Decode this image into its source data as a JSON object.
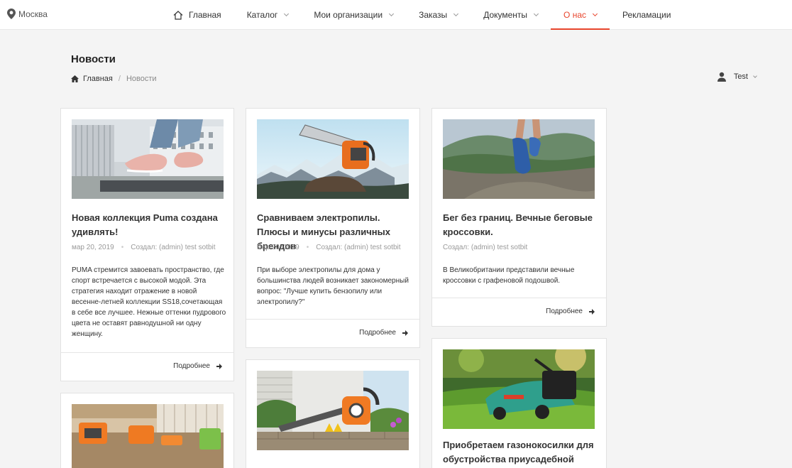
{
  "header": {
    "city": "Москва",
    "nav": [
      {
        "label": "Главная"
      },
      {
        "label": "Каталог"
      },
      {
        "label": "Мои организации"
      },
      {
        "label": "Заказы"
      },
      {
        "label": "Документы"
      },
      {
        "label": "О нас"
      },
      {
        "label": "Рекламации"
      }
    ]
  },
  "page": {
    "title": "Новости",
    "breadcrumb": {
      "home": "Главная",
      "separator": "/",
      "current": "Новости"
    },
    "user": "Test"
  },
  "colors": {
    "accent": "#e8452c"
  },
  "news": [
    {
      "image": "sneakers-photo",
      "title": "Новая коллекция Puma создана удивлять!",
      "date": "мар 20, 2019",
      "author": "Создал: (admin) test sotbit",
      "text": "PUMA стремится завоевать пространство, где спорт встречается с высокой модой. Эта стратегия находит отражение в новой весенне-летней коллекции SS18,сочетающая  в себе все лучшее. Нежные оттенки пудрового цвета не оставят равнодушной ни одну женщину.",
      "more": "Подробнее"
    },
    {
      "image": "chainsaw-photo",
      "title": "Сравниваем электропилы. Плюсы и минусы различных брендов",
      "date": "мар 20, 2019",
      "author": "Создал: (admin) test sotbit",
      "text": "При выборе электропилы для дома у большинства людей возникает закономерный вопрос: \"Лучше купить бензопилу или электропилу?\"",
      "more": "Подробнее"
    },
    {
      "image": "running-shoes-photo",
      "title": "Бег без границ. Вечные беговые кроссовки.",
      "author": "Создал: (admin) test sotbit",
      "text": "В Великобритании представили вечные кроссовки с графеновой подошвой.",
      "more": "Подробнее"
    },
    {
      "image": "garden-tools-photo"
    },
    {
      "image": "leaf-blower-photo"
    },
    {
      "image": "lawn-mower-photo",
      "title": "Приобретаем газонокосилки для обустройства приусадебной"
    }
  ]
}
